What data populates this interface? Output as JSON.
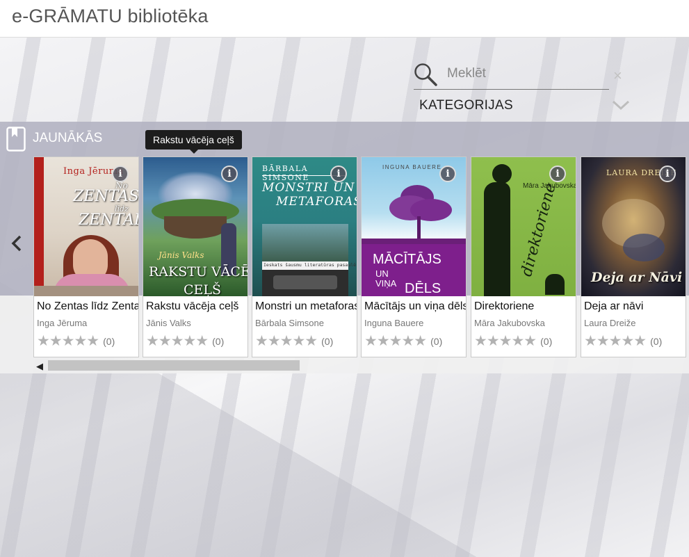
{
  "header": {
    "title": "e-GRĀMATU bibliotēka"
  },
  "search": {
    "placeholder": "Meklēt",
    "value": ""
  },
  "categories": {
    "label": "KATEGORIJAS"
  },
  "section": {
    "title": "JAUNĀKĀS",
    "tooltip": "Rakstu vācēja ceļš"
  },
  "books": [
    {
      "title": "No Zentas līdz Zentai",
      "author": "Inga Jēruma",
      "stars": "★★★★★",
      "rating_count": "(0)",
      "cover": {
        "author": "Inga Jēruma",
        "line1": "No",
        "line2": "ZENTAS",
        "line3": "līdz",
        "line4": "ZENTAI"
      }
    },
    {
      "title": "Rakstu vācēja ceļš",
      "author": "Jānis Valks",
      "stars": "★★★★★",
      "rating_count": "(0)",
      "cover": {
        "author": "Jānis Valks",
        "line1": "RAKSTU VĀCĒJA",
        "line2": "CEĻŠ"
      }
    },
    {
      "title": "Monstri un metaforas",
      "author": "Bārbala Simsone",
      "stars": "★★★★★",
      "rating_count": "(0)",
      "cover": {
        "author": "BĀRBALA SIMSONE",
        "line1": "MONSTRI UN",
        "line2": "METAFORAS",
        "subtitle": "Ieskats šausmu literatūras pasaulē"
      }
    },
    {
      "title": "Mācītājs un viņa dēls",
      "author": "Inguna Bauere",
      "stars": "★★★★★",
      "rating_count": "(0)",
      "cover": {
        "author": "INGUNA BAUERE",
        "line1": "MĀCĪTĀJS",
        "line2": "UN",
        "line3": "VIŅA",
        "line4": "DĒLS"
      }
    },
    {
      "title": "Direktoriene",
      "author": "Māra Jakubovska",
      "stars": "★★★★★",
      "rating_count": "(0)",
      "cover": {
        "author": "Māra Jakubovska",
        "line1": "direktoriene"
      }
    },
    {
      "title": "Deja ar nāvi",
      "author": "Laura Dreiže",
      "stars": "★★★★★",
      "rating_count": "(0)",
      "cover": {
        "author": "LAURA DREIŽE",
        "line1": "Deja ar Nāvi"
      }
    }
  ],
  "info_glyph": "i",
  "clear_glyph": "×",
  "scroll_left_glyph": "◀",
  "colors": {
    "band": "#b2b2c0",
    "tooltip": "#1d1d1d",
    "cover_red": "#b3201c",
    "cover_purple": "#7e1f8c",
    "cover_green": "#7fb041"
  }
}
